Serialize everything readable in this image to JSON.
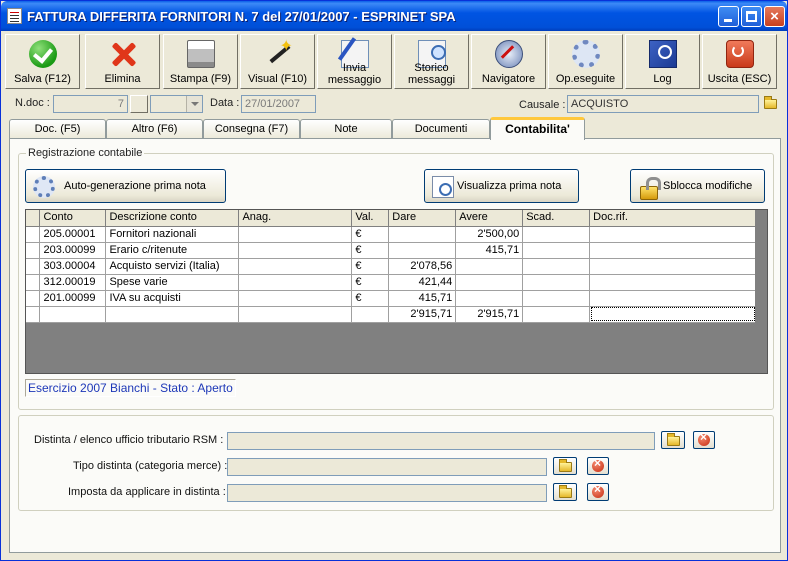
{
  "window": {
    "title": "FATTURA DIFFERITA FORNITORI N. 7  del 27/01/2007 - ESPRINET SPA",
    "min_label": "_",
    "close_label": "×"
  },
  "toolbar": [
    {
      "id": "save",
      "label": "Salva (F12)",
      "icon": "check-icon"
    },
    {
      "id": "delete",
      "label": "Elimina",
      "icon": "delete-x-icon"
    },
    {
      "id": "print",
      "label": "Stampa (F9)",
      "icon": "printer-icon"
    },
    {
      "id": "visual",
      "label": "Visual (F10)",
      "icon": "magic-wand-icon"
    },
    {
      "id": "send",
      "label": "Invia\nmessaggio",
      "icon": "mail-send-icon"
    },
    {
      "id": "history",
      "label": "Storico\nmessaggi",
      "icon": "mail-search-icon"
    },
    {
      "id": "navigator",
      "label": "Navigatore",
      "icon": "compass-icon"
    },
    {
      "id": "operations",
      "label": "Op.eseguite",
      "icon": "gears-icon"
    },
    {
      "id": "log",
      "label": "Log",
      "icon": "book-search-icon"
    },
    {
      "id": "exit",
      "label": "Uscita (ESC)",
      "icon": "power-icon"
    }
  ],
  "header": {
    "ndoc_label": "N.doc :",
    "ndoc_value": "7",
    "data_label": "Data :",
    "data_value": "27/01/2007",
    "causale_label": "Causale :",
    "causale_value": "ACQUISTO"
  },
  "tabs": [
    {
      "label": "Doc. (F5)",
      "active": false
    },
    {
      "label": "Altro (F6)",
      "active": false
    },
    {
      "label": "Consegna (F7)",
      "active": false
    },
    {
      "label": "Note",
      "active": false
    },
    {
      "label": "Documenti",
      "active": false
    },
    {
      "label": "Contabilita'",
      "active": true
    }
  ],
  "registrazione": {
    "legend": "Registrazione contabile",
    "auto_gen_label": "Auto-generazione prima nota",
    "visualizza_label": "Visualizza prima nota",
    "sblocca_label": "Sblocca modifiche"
  },
  "grid": {
    "columns": [
      "Conto",
      "Descrizione conto",
      "Anag.",
      "Val.",
      "Dare",
      "Avere",
      "Scad.",
      "Doc.rif."
    ],
    "rows": [
      {
        "conto": "205.00001",
        "descrizione": "Fornitori nazionali",
        "anag": "",
        "val": "€",
        "dare": "",
        "avere": "2'500,00",
        "scad": "",
        "docrif": ""
      },
      {
        "conto": "203.00099",
        "descrizione": "Erario c/ritenute",
        "anag": "",
        "val": "€",
        "dare": "",
        "avere": "415,71",
        "scad": "",
        "docrif": ""
      },
      {
        "conto": "303.00004",
        "descrizione": "Acquisto servizi (Italia)",
        "anag": "",
        "val": "€",
        "dare": "2'078,56",
        "avere": "",
        "scad": "",
        "docrif": ""
      },
      {
        "conto": "312.00019",
        "descrizione": "Spese varie",
        "anag": "",
        "val": "€",
        "dare": "421,44",
        "avere": "",
        "scad": "",
        "docrif": ""
      },
      {
        "conto": "201.00099",
        "descrizione": "IVA su acquisti",
        "anag": "",
        "val": "€",
        "dare": "415,71",
        "avere": "",
        "scad": "",
        "docrif": ""
      }
    ],
    "totals": {
      "dare": "2'915,71",
      "avere": "2'915,71"
    }
  },
  "status": "Esercizio 2007 Bianchi - Stato : Aperto",
  "distinta": {
    "ufficio_label": "Distinta / elenco ufficio tributario RSM :",
    "tipo_label": "Tipo distinta (categoria merce) :",
    "imposta_label": "Imposta da applicare in distinta :"
  }
}
